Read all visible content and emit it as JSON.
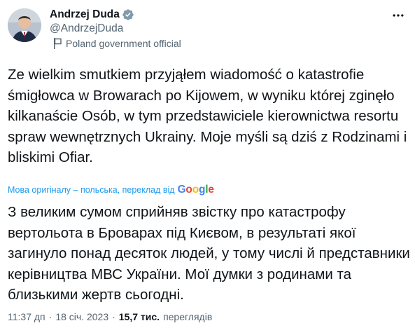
{
  "author": {
    "name": "Andrzej Duda",
    "handle": "@AndrzejDuda",
    "affiliation": "Poland government official"
  },
  "icons": {
    "verified": "verified-badge-icon",
    "flag": "flag-icon",
    "more": "more-options-icon"
  },
  "colors": {
    "accent": "#1d9bf0",
    "verified_badge": "#829aab",
    "secondary_text": "#536471"
  },
  "tweet": {
    "text": "Ze wielkim smutkiem przyjąłem wiadomość o katastrofie śmigłowca w Browarach po Kijowem, w wyniku której zginęło kilkanaście Osób, w tym przedstawiciele kierownictwa resortu spraw wewnętrznych Ukrainy. Moje myśli są dziś z Rodzinami i bliskimi Ofiar.",
    "translation_note": "Мова оригіналу – польська, переклад від",
    "translation_provider": "Google",
    "translated_text": "З великим сумом сприйняв звістку про катастрофу вертольота в Броварах під Києвом, в результаті якої загинуло понад десяток людей, у тому числі й представники керівництва МВС України. Мої думки з родинами та близькими жертв сьогодні."
  },
  "meta": {
    "time": "11:37 дп",
    "separator": "·",
    "date": "18 січ. 2023",
    "separator2": "·",
    "views_count": "15,7 тис.",
    "views_label": "переглядів"
  }
}
